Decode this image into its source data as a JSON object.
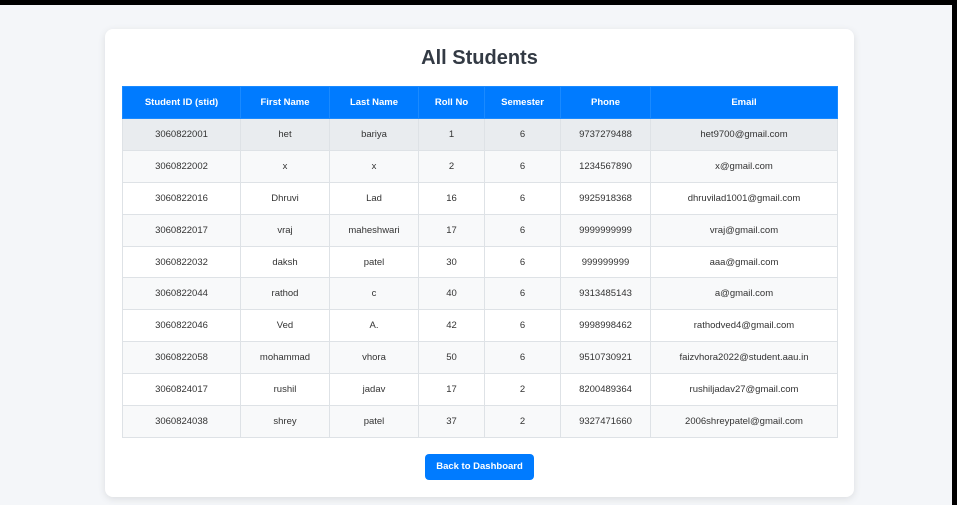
{
  "page": {
    "title": "All Students"
  },
  "table": {
    "headers": [
      "Student ID (stid)",
      "First Name",
      "Last Name",
      "Roll No",
      "Semester",
      "Phone",
      "Email"
    ],
    "rows": [
      [
        "3060822001",
        "het",
        "bariya",
        "1",
        "6",
        "9737279488",
        "het9700@gmail.com"
      ],
      [
        "3060822002",
        "x",
        "x",
        "2",
        "6",
        "1234567890",
        "x@gmail.com"
      ],
      [
        "3060822016",
        "Dhruvi",
        "Lad",
        "16",
        "6",
        "9925918368",
        "dhruvilad1001@gmail.com"
      ],
      [
        "3060822017",
        "vraj",
        "maheshwari",
        "17",
        "6",
        "9999999999",
        "vraj@gmail.com"
      ],
      [
        "3060822032",
        "daksh",
        "patel",
        "30",
        "6",
        "999999999",
        "aaa@gmail.com"
      ],
      [
        "3060822044",
        "rathod",
        "c",
        "40",
        "6",
        "9313485143",
        "a@gmail.com"
      ],
      [
        "3060822046",
        "Ved",
        "A.",
        "42",
        "6",
        "9998998462",
        "rathodved4@gmail.com"
      ],
      [
        "3060822058",
        "mohammad",
        "vhora",
        "50",
        "6",
        "9510730921",
        "faizvhora2022@student.aau.in"
      ],
      [
        "3060824017",
        "rushil",
        "jadav",
        "17",
        "2",
        "8200489364",
        "rushiljadav27@gmail.com"
      ],
      [
        "3060824038",
        "shrey",
        "patel",
        "37",
        "2",
        "9327471660",
        "2006shreypatel@gmail.com"
      ]
    ]
  },
  "actions": {
    "back_label": "Back to Dashboard"
  },
  "colors": {
    "accent": "#007bff",
    "page_background": "#f4f6f9",
    "card_background": "#ffffff",
    "title_text": "#333a44",
    "hover_row": "#e9ecef"
  }
}
